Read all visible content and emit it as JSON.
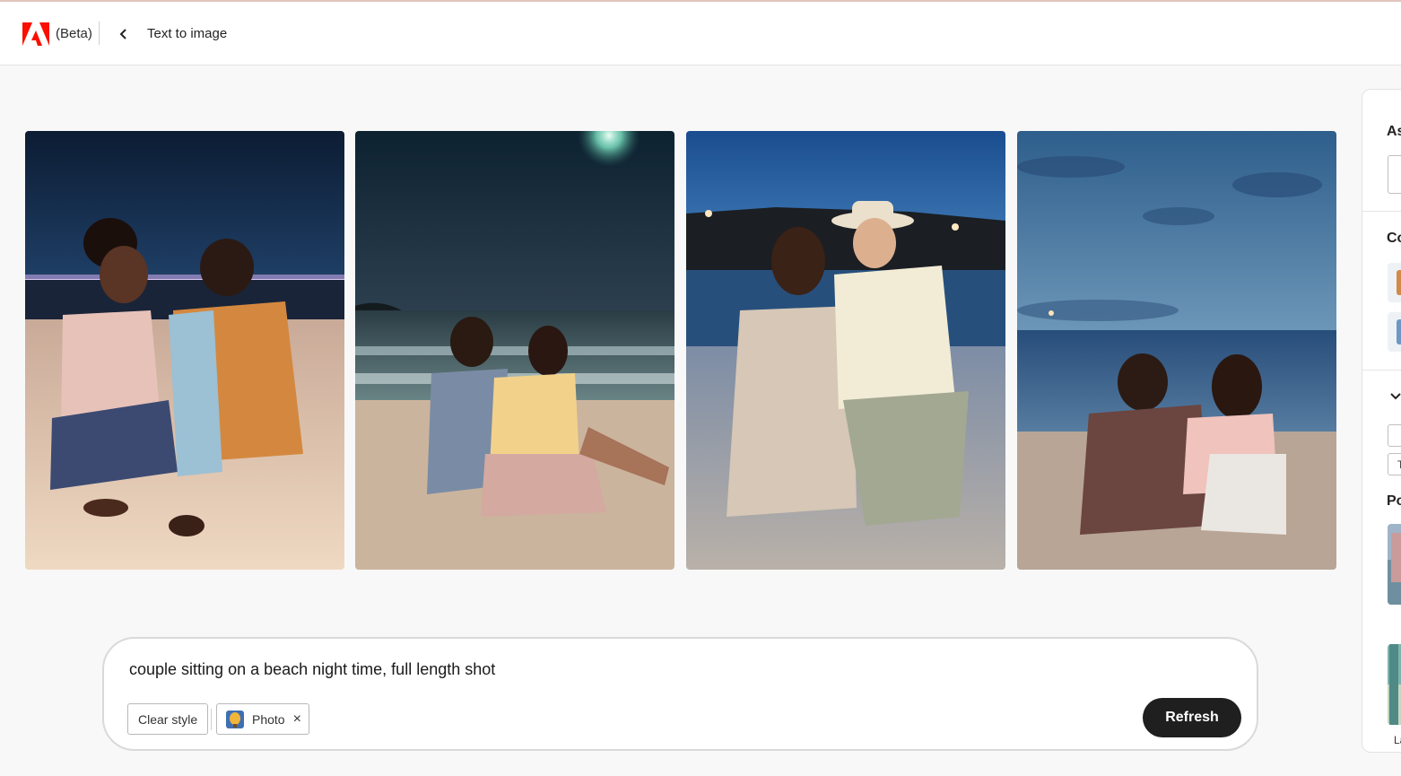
{
  "header": {
    "beta_label": "(Beta)",
    "title": "Text to image"
  },
  "prompt": {
    "text": "couple sitting on a beach night time, full length shot",
    "clear_style_label": "Clear style",
    "style_chip_label": "Photo",
    "remove_symbol": "×",
    "refresh_label": "Refresh"
  },
  "side_panel": {
    "aspect_label": "As",
    "content_label": "Co",
    "photo_label": "Po",
    "text_fragment": "T",
    "bottom_label": "La"
  },
  "colors": {
    "accent": "#fa0f00",
    "refresh_bg": "#1f1f1f"
  },
  "icons": [
    "adobe-logo",
    "chevron-left-icon",
    "close-icon",
    "chevron-down-icon"
  ]
}
